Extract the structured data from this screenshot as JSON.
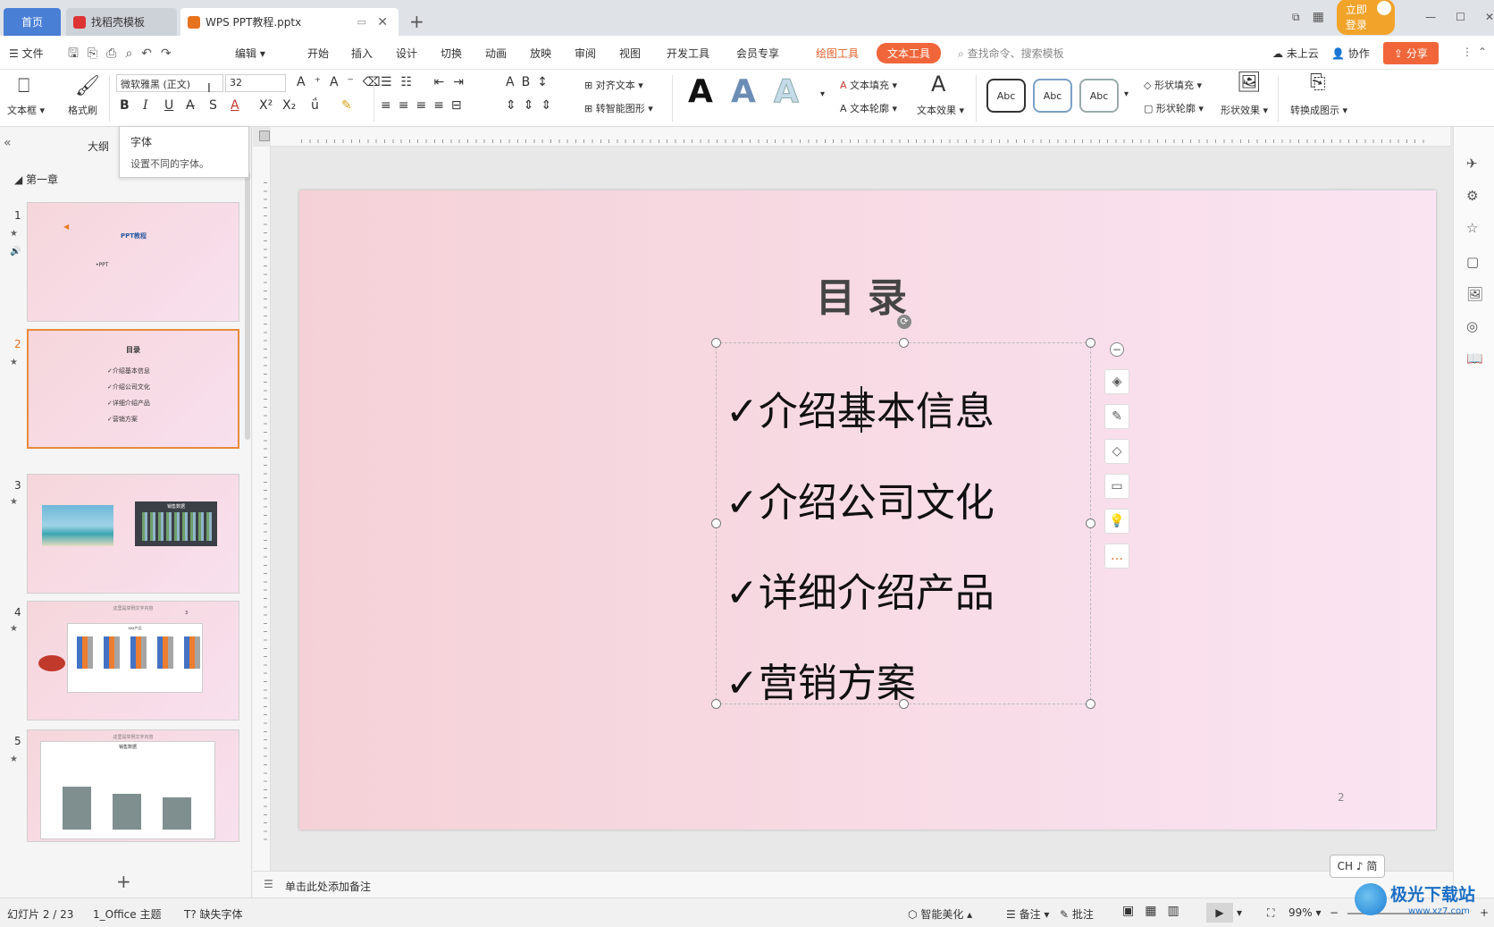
{
  "tabs": {
    "home": "首页",
    "template": "找稻壳模板",
    "doc": "WPS PPT教程.pptx"
  },
  "titlebar": {
    "login": "立即登录"
  },
  "menu": {
    "file": "文件",
    "edit": "编辑",
    "items": [
      "开始",
      "插入",
      "设计",
      "切换",
      "动画",
      "放映",
      "审阅",
      "视图",
      "开发工具",
      "会员专享"
    ],
    "draw_tools": "绘图工具",
    "text_tools": "文本工具",
    "search_placeholder": "查找命令、搜索模板",
    "cloud": "未上云",
    "collab": "协作",
    "share": "分享"
  },
  "ribbon": {
    "textbox": "文本框",
    "format_painter": "格式刷",
    "font_name": "微软雅黑 (正文)",
    "font_size": "32",
    "align_text": "对齐文本",
    "smart_art": "转智能图形",
    "text_fill": "文本填充",
    "text_outline": "文本轮廓",
    "text_effect": "文本效果",
    "shape_fill": "形状填充",
    "shape_outline": "形状轮廓",
    "shape_effect": "形状效果",
    "convert": "转换成图示",
    "abc": "Abc",
    "bigA": "A"
  },
  "tooltip": {
    "title": "字体",
    "desc": "设置不同的字体。"
  },
  "left_panel": {
    "outline": "大纲",
    "chapter": "第一章",
    "add": "+"
  },
  "thumbs": [
    {
      "num": "1",
      "title": "PPT教程",
      "sub": "•PPT"
    },
    {
      "num": "2",
      "title": "目录",
      "lines": [
        "✓介绍基本信息",
        "✓介绍公司文化",
        "✓详细介绍产品",
        "✓营销方案"
      ]
    },
    {
      "num": "3",
      "chart_title": "销售数据"
    },
    {
      "num": "4",
      "header": "这里是举例文字内容",
      "chart_title": "xxx产品",
      "page": "3"
    },
    {
      "num": "5",
      "header": "这里是举例文字内容",
      "chart_title": "销售数据"
    }
  ],
  "slide": {
    "title": "目录",
    "items": [
      "✓介绍基本信息",
      "✓介绍公司文化",
      "✓详细介绍产品",
      "✓营销方案"
    ],
    "page": "2"
  },
  "notes": {
    "placeholder": "单击此处添加备注"
  },
  "ime": "CH ♪ 简",
  "status": {
    "slide": "幻灯片 2 / 23",
    "theme": "1_Office 主题",
    "missing_font": "缺失字体",
    "beautify": "智能美化",
    "notes": "备注",
    "comment": "批注",
    "zoom": "99%"
  },
  "watermark": {
    "brand": "极光下载站",
    "url": "www.xz7.com"
  }
}
